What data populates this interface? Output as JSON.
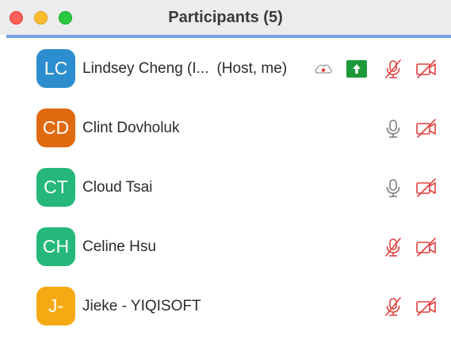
{
  "window": {
    "title": "Participants (5)"
  },
  "colors": {
    "muted_red": "#e0403f",
    "mic_gray": "#7a7a7a",
    "share_green": "#1c9a3a"
  },
  "participants": [
    {
      "initials": "LC",
      "name": "Lindsey Cheng (I...",
      "role": "(Host, me)",
      "avatar_color": "#2d8ecf",
      "icons": [
        "cloud-record-icon",
        "share-screen-icon",
        "mic-muted-icon",
        "video-off-icon"
      ]
    },
    {
      "initials": "CD",
      "name": "Clint Dovholuk",
      "role": "",
      "avatar_color": "#e06a10",
      "icons": [
        "mic-icon",
        "video-off-icon"
      ]
    },
    {
      "initials": "CT",
      "name": "Cloud Tsai",
      "role": "",
      "avatar_color": "#25b87a",
      "icons": [
        "mic-icon",
        "video-off-icon"
      ]
    },
    {
      "initials": "CH",
      "name": "Celine Hsu",
      "role": "",
      "avatar_color": "#25b87a",
      "icons": [
        "mic-muted-icon",
        "video-off-icon"
      ]
    },
    {
      "initials": "J-",
      "name": "Jieke - YIQISOFT",
      "role": "",
      "avatar_color": "#f5aa14",
      "icons": [
        "mic-muted-icon",
        "video-off-icon"
      ]
    }
  ]
}
